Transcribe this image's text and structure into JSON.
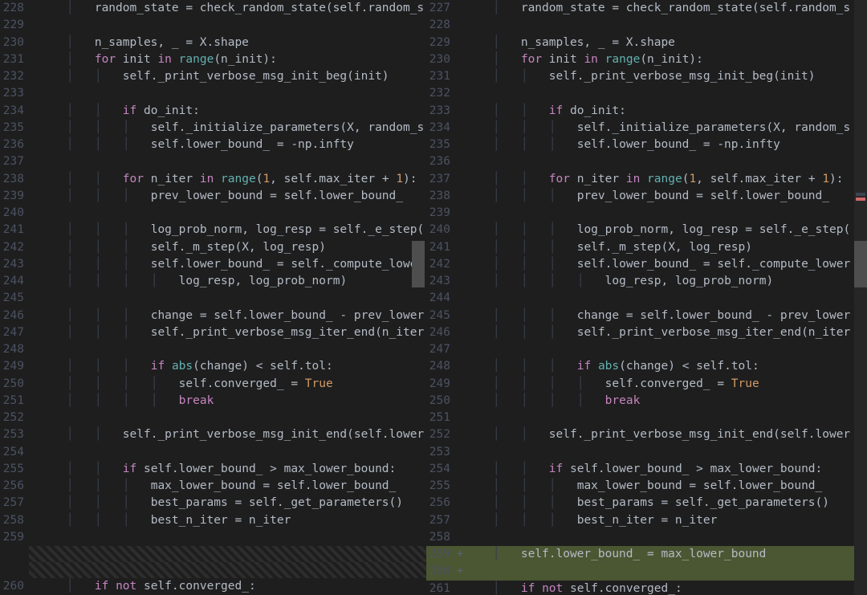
{
  "left": {
    "lines": [
      {
        "n": "228",
        "t": "        random_state = check_random_state(self.random_s"
      },
      {
        "n": "229",
        "t": ""
      },
      {
        "n": "230",
        "t": "        n_samples, _ = X.shape"
      },
      {
        "n": "231",
        "t": "        for init in range(n_init):"
      },
      {
        "n": "232",
        "t": "            self._print_verbose_msg_init_beg(init)"
      },
      {
        "n": "233",
        "t": ""
      },
      {
        "n": "234",
        "t": "            if do_init:"
      },
      {
        "n": "235",
        "t": "                self._initialize_parameters(X, random_s"
      },
      {
        "n": "236",
        "t": "                self.lower_bound_ = -np.infty"
      },
      {
        "n": "237",
        "t": ""
      },
      {
        "n": "238",
        "t": "            for n_iter in range(1, self.max_iter + 1):"
      },
      {
        "n": "239",
        "t": "                prev_lower_bound = self.lower_bound_"
      },
      {
        "n": "240",
        "t": ""
      },
      {
        "n": "241",
        "t": "                log_prob_norm, log_resp = self._e_step("
      },
      {
        "n": "242",
        "t": "                self._m_step(X, log_resp)"
      },
      {
        "n": "243",
        "t": "                self.lower_bound_ = self._compute_lower"
      },
      {
        "n": "244",
        "t": "                    log_resp, log_prob_norm)"
      },
      {
        "n": "245",
        "t": ""
      },
      {
        "n": "246",
        "t": "                change = self.lower_bound_ - prev_lower"
      },
      {
        "n": "247",
        "t": "                self._print_verbose_msg_iter_end(n_iter"
      },
      {
        "n": "248",
        "t": ""
      },
      {
        "n": "249",
        "t": "                if abs(change) < self.tol:"
      },
      {
        "n": "250",
        "t": "                    self.converged_ = True"
      },
      {
        "n": "251",
        "t": "                    break"
      },
      {
        "n": "252",
        "t": ""
      },
      {
        "n": "253",
        "t": "            self._print_verbose_msg_init_end(self.lower"
      },
      {
        "n": "254",
        "t": ""
      },
      {
        "n": "255",
        "t": "            if self.lower_bound_ > max_lower_bound:"
      },
      {
        "n": "256",
        "t": "                max_lower_bound = self.lower_bound_"
      },
      {
        "n": "257",
        "t": "                best_params = self._get_parameters()"
      },
      {
        "n": "258",
        "t": "                best_n_iter = n_iter"
      },
      {
        "n": "259",
        "t": ""
      },
      {
        "n": "",
        "t": "",
        "hatch": true
      },
      {
        "n": "",
        "t": "",
        "hatch": true
      },
      {
        "n": "260",
        "t": "        if not self.converged_:"
      }
    ]
  },
  "right": {
    "lines": [
      {
        "n": "227",
        "t": "        random_state = check_random_state(self.random_s"
      },
      {
        "n": "228",
        "t": ""
      },
      {
        "n": "229",
        "t": "        n_samples, _ = X.shape"
      },
      {
        "n": "230",
        "t": "        for init in range(n_init):"
      },
      {
        "n": "231",
        "t": "            self._print_verbose_msg_init_beg(init)"
      },
      {
        "n": "232",
        "t": ""
      },
      {
        "n": "233",
        "t": "            if do_init:"
      },
      {
        "n": "234",
        "t": "                self._initialize_parameters(X, random_s"
      },
      {
        "n": "235",
        "t": "                self.lower_bound_ = -np.infty"
      },
      {
        "n": "236",
        "t": ""
      },
      {
        "n": "237",
        "t": "            for n_iter in range(1, self.max_iter + 1):"
      },
      {
        "n": "238",
        "t": "                prev_lower_bound = self.lower_bound_"
      },
      {
        "n": "239",
        "t": ""
      },
      {
        "n": "240",
        "t": "                log_prob_norm, log_resp = self._e_step("
      },
      {
        "n": "241",
        "t": "                self._m_step(X, log_resp)"
      },
      {
        "n": "242",
        "t": "                self.lower_bound_ = self._compute_lower"
      },
      {
        "n": "243",
        "t": "                    log_resp, log_prob_norm)"
      },
      {
        "n": "244",
        "t": ""
      },
      {
        "n": "245",
        "t": "                change = self.lower_bound_ - prev_lower"
      },
      {
        "n": "246",
        "t": "                self._print_verbose_msg_iter_end(n_iter"
      },
      {
        "n": "247",
        "t": ""
      },
      {
        "n": "248",
        "t": "                if abs(change) < self.tol:"
      },
      {
        "n": "249",
        "t": "                    self.converged_ = True"
      },
      {
        "n": "250",
        "t": "                    break"
      },
      {
        "n": "251",
        "t": ""
      },
      {
        "n": "252",
        "t": "            self._print_verbose_msg_init_end(self.lower"
      },
      {
        "n": "253",
        "t": ""
      },
      {
        "n": "254",
        "t": "            if self.lower_bound_ > max_lower_bound:"
      },
      {
        "n": "255",
        "t": "                max_lower_bound = self.lower_bound_"
      },
      {
        "n": "256",
        "t": "                best_params = self._get_parameters()"
      },
      {
        "n": "257",
        "t": "                best_n_iter = n_iter"
      },
      {
        "n": "258",
        "t": ""
      },
      {
        "n": "259",
        "s": "+",
        "t": "        self.lower_bound_ = max_lower_bound",
        "added": true
      },
      {
        "n": "260",
        "s": "+",
        "t": "",
        "added": true
      },
      {
        "n": "261",
        "t": "        if not self.converged_:"
      }
    ]
  },
  "syntax": {
    "keywords": [
      "for",
      "in",
      "if",
      "not",
      "break"
    ],
    "builtins": [
      "range",
      "abs"
    ],
    "bools": [
      "True"
    ]
  }
}
